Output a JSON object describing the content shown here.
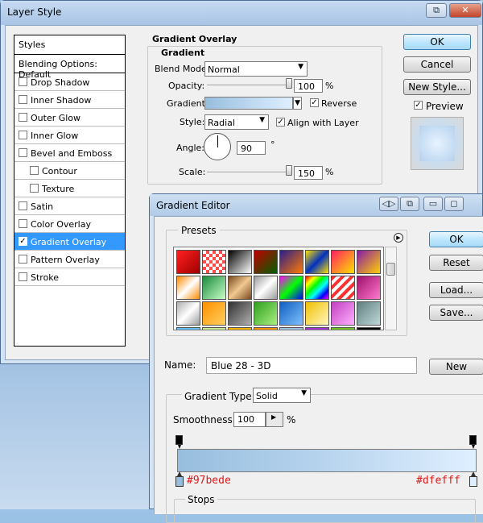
{
  "layer_style": {
    "title": "Layer Style",
    "titlebar_buttons": {
      "restore": "⧉",
      "close": "✕"
    },
    "styles_header": "Styles",
    "blending_options": "Blending Options: Default",
    "styles": [
      {
        "label": "Drop Shadow",
        "checked": false
      },
      {
        "label": "Inner Shadow",
        "checked": false
      },
      {
        "label": "Outer Glow",
        "checked": false
      },
      {
        "label": "Inner Glow",
        "checked": false
      },
      {
        "label": "Bevel and Emboss",
        "checked": false
      },
      {
        "label": "Contour",
        "checked": false,
        "sub": true
      },
      {
        "label": "Texture",
        "checked": false,
        "sub": true
      },
      {
        "label": "Satin",
        "checked": false
      },
      {
        "label": "Color Overlay",
        "checked": false
      },
      {
        "label": "Gradient Overlay",
        "checked": true,
        "selected": true
      },
      {
        "label": "Pattern Overlay",
        "checked": false
      },
      {
        "label": "Stroke",
        "checked": false
      }
    ],
    "section_title": "Gradient Overlay",
    "group_title": "Gradient",
    "blend_mode_label": "Blend Mode:",
    "blend_mode_value": "Normal",
    "opacity_label": "Opacity:",
    "opacity_value": "100",
    "opacity_unit": "%",
    "opacity_fraction": 1.0,
    "gradient_label": "Gradient:",
    "reverse_label": "Reverse",
    "reverse_checked": true,
    "style_label": "Style:",
    "style_value": "Radial",
    "align_label": "Align with Layer",
    "align_checked": true,
    "angle_label": "Angle:",
    "angle_value": "90",
    "angle_unit": "°",
    "scale_label": "Scale:",
    "scale_value": "150",
    "scale_unit": "%",
    "scale_fraction": 1.0,
    "buttons": {
      "ok": "OK",
      "cancel": "Cancel",
      "new_style": "New Style..."
    },
    "preview_label": "Preview",
    "preview_checked": true
  },
  "gradient_editor": {
    "title": "Gradient Editor",
    "titlebar_buttons": {
      "back": "◁▷",
      "copy": "⧉",
      "minimize": "▭",
      "maximize": "◻"
    },
    "presets_label": "Presets",
    "presets_menu_icon": "▶",
    "preset_swatches": [
      "linear-gradient(135deg,#ff2020,#a00000)",
      "repeating-conic-gradient(#ff4d4d 0 25%,#ffffff 0 50%) 0 0/8px 8px",
      "linear-gradient(135deg,#000,#fff)",
      "linear-gradient(135deg,#c00000,#006000)",
      "linear-gradient(135deg,#2a1e8c,#ff7a00)",
      "linear-gradient(135deg,#ffe000,#0030c0,#ffe000)",
      "linear-gradient(135deg,#ff2060,#ffe000)",
      "linear-gradient(135deg,#8a1aa8,#ffd000)",
      "linear-gradient(135deg,#ff8a00,#fff,#ff8a00)",
      "linear-gradient(135deg,#1a8a3a,#c8ffc8)",
      "linear-gradient(135deg,#7a4a20,#f0c890,#7a4a20)",
      "linear-gradient(135deg,#9a9a9a,#fff,#9a9a9a)",
      "linear-gradient(135deg,#ff00ff,#00ff00,#0000ff)",
      "linear-gradient(135deg,#ff0000,#ffff00,#00ff00,#00ffff,#0000ff,#ff00ff)",
      "repeating-linear-gradient(135deg,#ff3030 0 4px,#ffffff 4px 8px)",
      "linear-gradient(135deg,#a0106a,#ff7ad0)",
      "linear-gradient(135deg,#b0b0b0,#ffffff,#9a9a9a)",
      "linear-gradient(135deg,#ff9000,#ffd060)",
      "linear-gradient(135deg,#303030,#b0b0b0)",
      "linear-gradient(135deg,#30a020,#a8f080)",
      "linear-gradient(135deg,#1060c0,#80c0ff)",
      "linear-gradient(135deg,#f0c000,#fff7c0)",
      "linear-gradient(135deg,#c040c0,#ffb0ff)",
      "linear-gradient(135deg,#608080,#c0d8d8)",
      "linear-gradient(180deg,#60c0ff,#c0e8ff)",
      "linear-gradient(180deg,#c8e890,#f0ffd0)",
      "linear-gradient(180deg,#ffb000,#ffe080)",
      "linear-gradient(180deg,#ff9000,#ffd000)",
      "linear-gradient(180deg,#a0c0e0,#e0f0ff)",
      "linear-gradient(180deg,#a030d0,#e0a0ff)",
      "linear-gradient(180deg,#70c020,#b0f060)",
      "linear-gradient(180deg,#000,#606060)"
    ],
    "buttons": {
      "ok": "OK",
      "reset": "Reset",
      "load": "Load...",
      "save": "Save..."
    },
    "name_label": "Name:",
    "name_value": "Blue 28 - 3D",
    "new_button": "New",
    "gradient_type_label": "Gradient Type:",
    "gradient_type_value": "Solid",
    "smoothness_label": "Smoothness:",
    "smoothness_value": "100",
    "smoothness_unit": "%",
    "start_color": "#97bede",
    "end_color": "#dfefff",
    "stops_label": "Stops"
  }
}
